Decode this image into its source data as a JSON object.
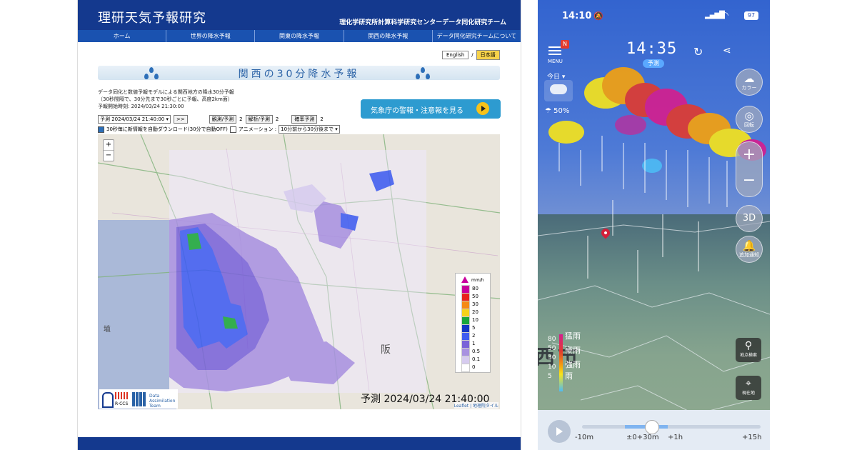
{
  "web": {
    "site_title": "理研天気予報研究",
    "site_subtitle": "理化学研究所計算科学研究センターデータ同化研究チーム",
    "nav": [
      "ホーム",
      "世界の降水予報",
      "関東の降水予報",
      "関西の降水予報",
      "データ同化研究チームについて"
    ],
    "lang": {
      "en": "English",
      "sep": "/",
      "ja": "日本語"
    },
    "page_title": "関西の30分降水予報",
    "desc_line1": "データ同化と数値予報モデルによる関西地方の降水30分予報",
    "desc_line2": "（30秒間隔で、30分先まで30秒ごとに予報、高度2km面）",
    "desc_line3": "予報開始時刻: 2024/03/24 21:30:00",
    "warning_button": "気象庁の警報・注意報を見る",
    "controls": {
      "time_select": "予測 2024/03/24 21:40:00 ▾",
      "next_btn": ">>",
      "obs_btn": "観測/予測",
      "obs_num": "2",
      "anal_btn": "解析/予測",
      "anal_num": "2",
      "prob_btn": "確率予測",
      "prob_num": "2",
      "auto_download": "30秒毎に新情報を自動ダウンロード(30分で自動OFF)",
      "animation": "アニメーション :",
      "anim_select": "10分前から30分後まで ▾"
    },
    "map": {
      "zoom_in": "+",
      "zoom_out": "−",
      "legend_unit": "mm/h",
      "legend": [
        {
          "label": "80",
          "color": "#c8009c"
        },
        {
          "label": "50",
          "color": "#e8231c"
        },
        {
          "label": "30",
          "color": "#f58a16"
        },
        {
          "label": "20",
          "color": "#f7d21a"
        },
        {
          "label": "10",
          "color": "#1aa53a"
        },
        {
          "label": "5",
          "color": "#1436c4"
        },
        {
          "label": "2",
          "color": "#3f5cf0"
        },
        {
          "label": "1",
          "color": "#7a63d8"
        },
        {
          "label": "0.5",
          "color": "#a891e0"
        },
        {
          "label": "0.1",
          "color": "#d6cbef"
        },
        {
          "label": "0",
          "color": "#ffffff"
        }
      ],
      "forecast_stamp": "予測 2024/03/24 21:40:00",
      "attribution": "Leaflet | 地理院タイル",
      "logo_text": "Data Assimilation Team",
      "logo_rccs": "R-CCS"
    }
  },
  "phone": {
    "status_time": "14:10",
    "battery": "97",
    "menu_label": "MENU",
    "menu_badge": "N",
    "display_time": "14:35",
    "mode": "予測",
    "today": "今日",
    "rain_prob": "50%",
    "buttons": {
      "color": "カラー",
      "rotate": "回転",
      "three_d": "3D",
      "notify": "追加通知",
      "search": "地点検索",
      "location": "現在地"
    },
    "legend": {
      "nums": [
        "80",
        "50",
        "30",
        "10",
        "5"
      ],
      "labels": [
        "猛雨",
        "豪雨",
        "強雨",
        "雨"
      ]
    },
    "city_text": "西市",
    "timeline": {
      "labels": [
        "-10m",
        "±0+30m",
        "+1h",
        "+15h"
      ]
    }
  }
}
